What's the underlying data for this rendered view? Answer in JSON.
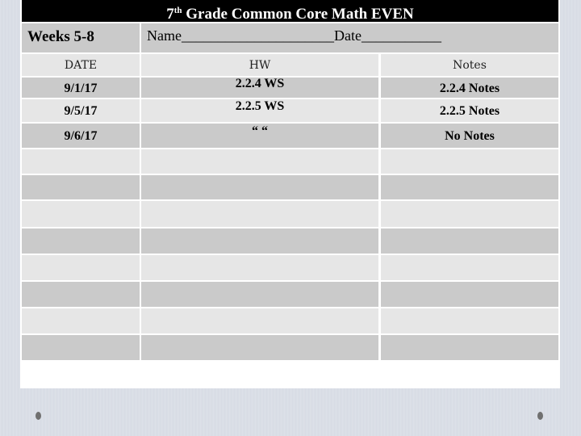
{
  "title": {
    "prefix": "7",
    "superscript": "th",
    "text": " Grade Common Core Math EVEN"
  },
  "weeks_label": "Weeks 5-8",
  "name_date_line": "Name_____________________Date___________",
  "columns": [
    "DATE",
    "HW",
    "Notes"
  ],
  "rows": [
    {
      "date": "9/1/17",
      "hw": "2.2.4 WS",
      "notes": "2.2.4 Notes"
    },
    {
      "date": "9/5/17",
      "hw": "2.2.5 WS",
      "notes": "2.2.5 Notes"
    },
    {
      "date": "9/6/17",
      "hw": "“  “",
      "notes": "No Notes"
    },
    {
      "date": "",
      "hw": "",
      "notes": ""
    },
    {
      "date": "",
      "hw": "",
      "notes": ""
    },
    {
      "date": "",
      "hw": "",
      "notes": ""
    },
    {
      "date": "",
      "hw": "",
      "notes": ""
    },
    {
      "date": "",
      "hw": "",
      "notes": ""
    },
    {
      "date": "",
      "hw": "",
      "notes": ""
    },
    {
      "date": "",
      "hw": "",
      "notes": ""
    },
    {
      "date": "",
      "hw": "",
      "notes": ""
    }
  ],
  "slide_bullets": [
    "left-bullet",
    "right-bullet"
  ]
}
